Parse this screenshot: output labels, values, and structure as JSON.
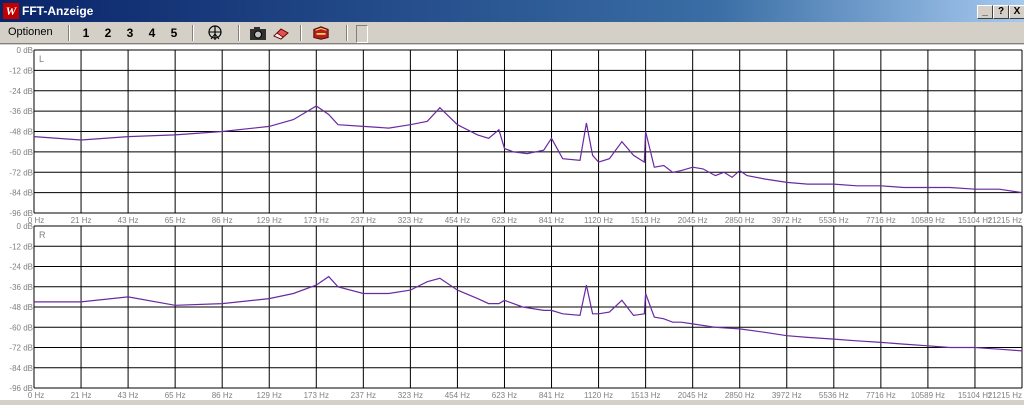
{
  "window": {
    "title": "FFT-Anzeige",
    "icon": "W",
    "controls": {
      "minimize": "_",
      "help": "?",
      "close": "X"
    }
  },
  "toolbar": {
    "menu_label": "Optionen",
    "channel_buttons": [
      "1",
      "2",
      "3",
      "4",
      "5"
    ],
    "icons": [
      "antenna-icon",
      "camera-icon",
      "eraser-icon",
      "book-icon"
    ]
  },
  "colors": {
    "trace": "#6a2aa0",
    "grid": "#000000",
    "label": "#808080"
  },
  "chart_data": [
    {
      "type": "line",
      "channel_label": "L",
      "x_tick_labels": [
        "0 Hz",
        "21 Hz",
        "43 Hz",
        "65 Hz",
        "86 Hz",
        "129 Hz",
        "173 Hz",
        "237 Hz",
        "323 Hz",
        "454 Hz",
        "623 Hz",
        "841 Hz",
        "1120 Hz",
        "1513 Hz",
        "2045 Hz",
        "2850 Hz",
        "3972 Hz",
        "5536 Hz",
        "7716 Hz",
        "10589 Hz",
        "15104 Hz",
        "21215 Hz"
      ],
      "y_tick_labels": [
        "0 dB",
        "-12 dB",
        "-24 dB",
        "-36 dB",
        "-48 dB",
        "-60 dB",
        "-72 dB",
        "-84 dB",
        "-96 dB"
      ],
      "ylim": [
        -96,
        0
      ],
      "grid": true,
      "x_scale": "log",
      "series": [
        {
          "x": [
            0,
            21,
            43,
            65,
            86,
            129,
            150,
            173,
            188,
            200,
            237,
            280,
            323,
            365,
            400,
            454,
            520,
            560,
            600,
            623,
            660,
            720,
            800,
            841,
            900,
            1000,
            1040,
            1080,
            1120,
            1200,
            1300,
            1400,
            1500,
            1513,
            1600,
            1700,
            1800,
            1900,
            2045,
            2200,
            2400,
            2550,
            2700,
            2850,
            3000,
            3400,
            3972,
            4600,
            5536,
            6500,
            7716,
            9000,
            10589,
            12500,
            15104,
            18000,
            21215
          ],
          "y": [
            -51,
            -53,
            -51,
            -50,
            -48,
            -45,
            -41,
            -33,
            -38,
            -44,
            -45,
            -46,
            -44,
            -42,
            -34,
            -44,
            -50,
            -52,
            -47,
            -58,
            -60,
            -61,
            -59,
            -52,
            -64,
            -65,
            -43,
            -62,
            -66,
            -64,
            -54,
            -62,
            -66,
            -48,
            -69,
            -68,
            -72,
            -71,
            -69,
            -70,
            -74,
            -72,
            -75,
            -71,
            -74,
            -76,
            -78,
            -79,
            -79,
            -80,
            -80,
            -81,
            -81,
            -81,
            -82,
            -82,
            -84
          ]
        }
      ]
    },
    {
      "type": "line",
      "channel_label": "R",
      "x_tick_labels": [
        "0 Hz",
        "21 Hz",
        "43 Hz",
        "65 Hz",
        "86 Hz",
        "129 Hz",
        "173 Hz",
        "237 Hz",
        "323 Hz",
        "454 Hz",
        "623 Hz",
        "841 Hz",
        "1120 Hz",
        "1513 Hz",
        "2045 Hz",
        "2850 Hz",
        "3972 Hz",
        "5536 Hz",
        "7716 Hz",
        "10589 Hz",
        "15104 Hz",
        "21215 Hz"
      ],
      "y_tick_labels": [
        "0 dB",
        "-12 dB",
        "-24 dB",
        "-36 dB",
        "-48 dB",
        "-60 dB",
        "-72 dB",
        "-84 dB",
        "-96 dB"
      ],
      "ylim": [
        -96,
        0
      ],
      "grid": true,
      "x_scale": "log",
      "series": [
        {
          "x": [
            0,
            21,
            43,
            65,
            86,
            129,
            150,
            173,
            188,
            200,
            237,
            280,
            323,
            365,
            400,
            454,
            520,
            560,
            600,
            623,
            700,
            800,
            841,
            900,
            1000,
            1040,
            1080,
            1120,
            1200,
            1300,
            1400,
            1500,
            1513,
            1600,
            1700,
            1800,
            1900,
            2045,
            2400,
            2850,
            3400,
            3972,
            4600,
            5536,
            6500,
            7716,
            9000,
            10589,
            12500,
            15104,
            18000,
            21215
          ],
          "y": [
            -45,
            -45,
            -42,
            -47,
            -46,
            -43,
            -40,
            -35,
            -30,
            -36,
            -40,
            -40,
            -38,
            -33,
            -31,
            -38,
            -43,
            -46,
            -46,
            -44,
            -48,
            -50,
            -50,
            -52,
            -53,
            -35,
            -52,
            -52,
            -51,
            -44,
            -53,
            -52,
            -40,
            -54,
            -55,
            -57,
            -57,
            -58,
            -60,
            -61,
            -63,
            -65,
            -66,
            -67,
            -68,
            -69,
            -70,
            -71,
            -72,
            -72,
            -73,
            -74
          ]
        }
      ]
    }
  ]
}
